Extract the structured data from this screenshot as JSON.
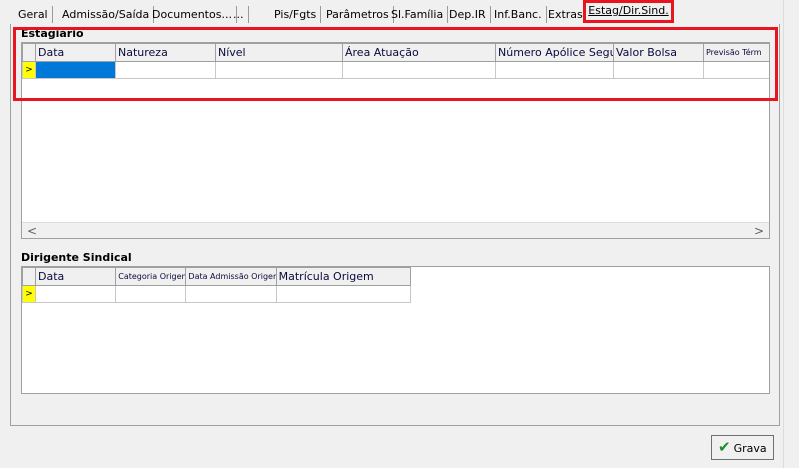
{
  "tabs": [
    {
      "label": "Geral"
    },
    {
      "label": "Admissão/Saída"
    },
    {
      "label": "Documentos..."
    },
    {
      "label": "..."
    },
    {
      "label": "Pis/Fgts"
    },
    {
      "label": "Parâmetros"
    },
    {
      "label": "Sl.Família"
    },
    {
      "label": "Dep.IR"
    },
    {
      "label": "Inf.Banc."
    },
    {
      "label": "Extras"
    }
  ],
  "active_tab": {
    "label": "Estag/Dir.Sind."
  },
  "estagiario": {
    "title": "Estagiário",
    "columns": [
      "Data",
      "Natureza",
      "Nível",
      "Área Atuação",
      "Número Apólice Seguro",
      "Valor Bolsa",
      "Previsão Térm"
    ],
    "row_marker": ">"
  },
  "dirigente": {
    "title": "Dirigente Sindical",
    "columns": [
      "Data",
      "Categoria Origem",
      "Data Admissão Origem",
      "Matrícula Origem"
    ],
    "row_marker": ">"
  },
  "scroll": {
    "left": "<",
    "right": ">"
  },
  "grava": {
    "label": "Grava"
  },
  "colors": {
    "highlight": "#e8141e",
    "selected_cell": "#0078d7",
    "row_indicator": "#ffff00"
  }
}
